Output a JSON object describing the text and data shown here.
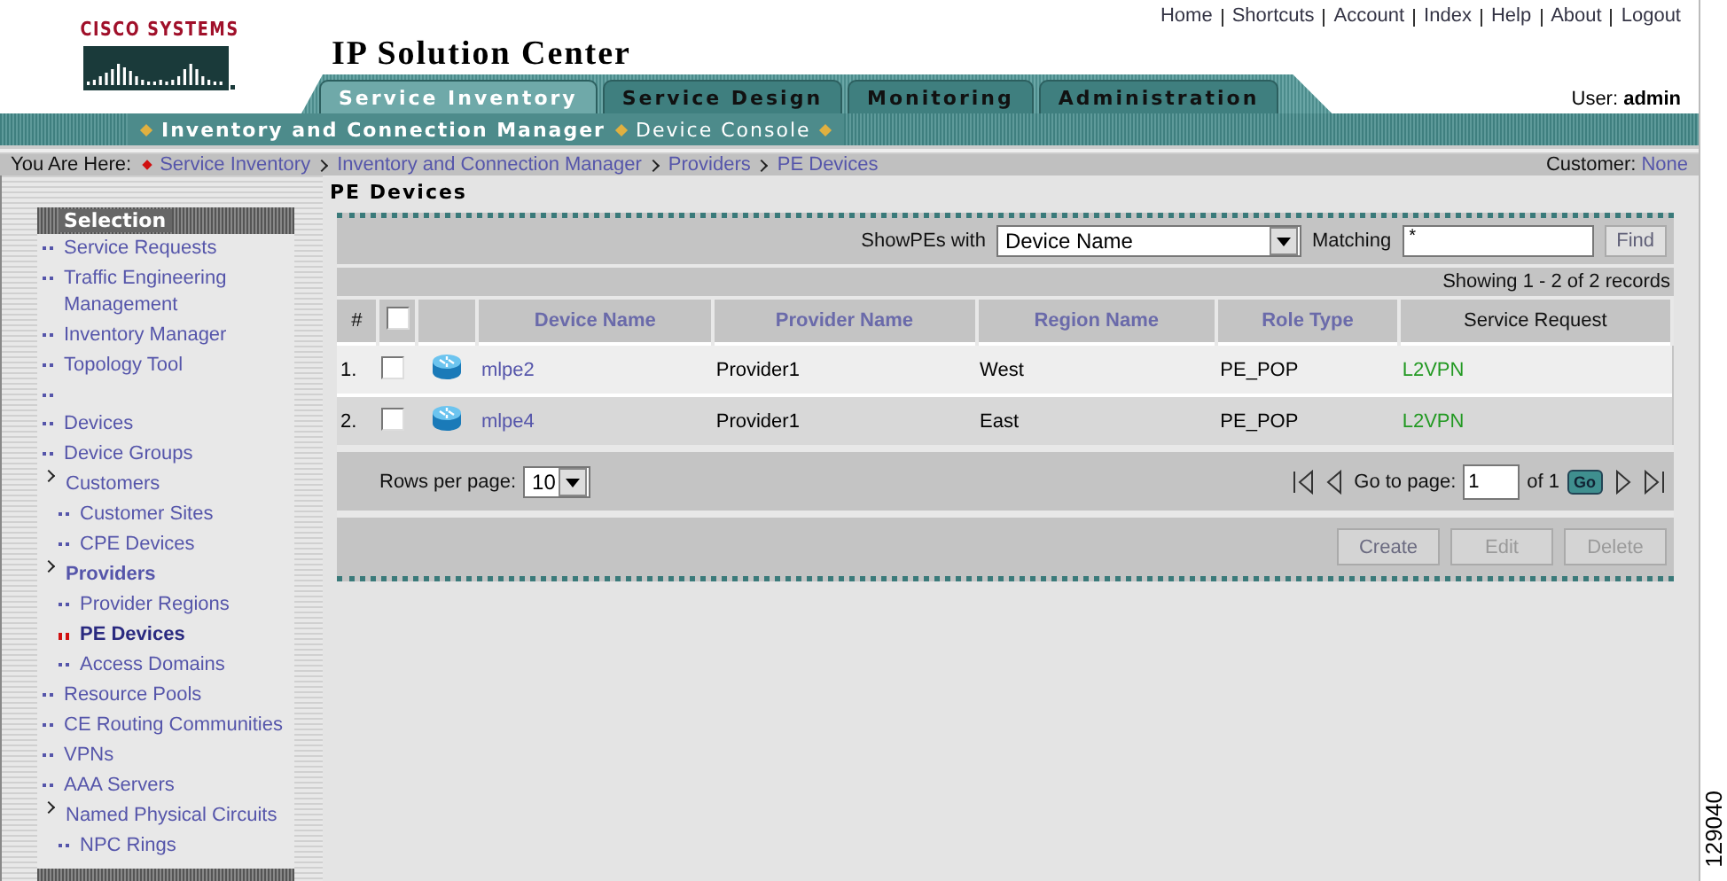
{
  "brand": {
    "company": "CISCO SYSTEMS",
    "title": "IP Solution Center"
  },
  "top_links": [
    "Home",
    "Shortcuts",
    "Account",
    "Index",
    "Help",
    "About",
    "Logout"
  ],
  "tabs": [
    {
      "label": "Service Inventory",
      "selected": true
    },
    {
      "label": "Service Design",
      "selected": false
    },
    {
      "label": "Monitoring",
      "selected": false
    },
    {
      "label": "Administration",
      "selected": false
    }
  ],
  "user": {
    "label": "User:",
    "name": "admin"
  },
  "subnav": [
    {
      "label": "Inventory and Connection Manager",
      "selected": true
    },
    {
      "label": "Device Console",
      "selected": false
    }
  ],
  "breadcrumb": {
    "label": "You Are Here:",
    "items": [
      "Service Inventory",
      "Inventory and Connection Manager",
      "Providers",
      "PE Devices"
    ],
    "customer_label": "Customer:",
    "customer": "None"
  },
  "sidebar": {
    "title": "Selection",
    "items": [
      {
        "label": "Service Requests",
        "kind": "item",
        "selected": false
      },
      {
        "label": "Traffic Engineering Management",
        "kind": "item",
        "selected": false
      },
      {
        "label": "Inventory Manager",
        "kind": "item",
        "selected": false
      },
      {
        "label": "Topology Tool",
        "kind": "item",
        "selected": false
      },
      {
        "kind": "blank",
        "selected": false
      },
      {
        "label": "Devices",
        "kind": "item",
        "selected": false
      },
      {
        "label": "Device Groups",
        "kind": "item",
        "selected": false
      },
      {
        "label": "Customers",
        "kind": "item",
        "selected": false,
        "expanded": true,
        "children": [
          {
            "label": "Customer Sites",
            "kind": "item",
            "selected": false
          },
          {
            "label": "CPE Devices",
            "kind": "item",
            "selected": false
          }
        ]
      },
      {
        "label": "Providers",
        "kind": "item",
        "selected": false,
        "expanded": true,
        "active": true,
        "children": [
          {
            "label": "Provider Regions",
            "kind": "item",
            "selected": false
          },
          {
            "label": "PE Devices",
            "kind": "item",
            "selected": true
          },
          {
            "label": "Access Domains",
            "kind": "item",
            "selected": false
          }
        ]
      },
      {
        "label": "Resource Pools",
        "kind": "item",
        "selected": false
      },
      {
        "label": "CE Routing Communities",
        "kind": "item",
        "selected": false
      },
      {
        "label": "VPNs",
        "kind": "item",
        "selected": false
      },
      {
        "label": "AAA Servers",
        "kind": "item",
        "selected": false
      },
      {
        "label": "Named Physical Circuits",
        "kind": "item",
        "selected": false,
        "expanded": true,
        "children": [
          {
            "label": "NPC Rings",
            "kind": "item",
            "selected": false
          }
        ]
      }
    ]
  },
  "page_title": "PE Devices",
  "filter": {
    "label": "ShowPEs with",
    "field": "Device Name",
    "matching_label": "Matching",
    "matching": "*",
    "button": "Find"
  },
  "summary": "Showing 1 - 2 of 2 records",
  "table": {
    "columns": [
      {
        "label": "#",
        "sortable": false
      },
      {
        "kind": "checkbox",
        "checked": false
      },
      {
        "kind": "icon"
      },
      {
        "label": "Device Name",
        "sortable": true
      },
      {
        "label": "Provider Name",
        "sortable": true
      },
      {
        "label": "Region Name",
        "sortable": true
      },
      {
        "label": "Role Type",
        "sortable": true
      },
      {
        "label": "Service Request",
        "sortable": false
      }
    ],
    "rows": [
      {
        "index": "1.",
        "checked": false,
        "device": "mlpe2",
        "provider": "Provider1",
        "region": "West",
        "role": "PE_POP",
        "service": "L2VPN"
      },
      {
        "index": "2.",
        "checked": false,
        "device": "mlpe4",
        "provider": "Provider1",
        "region": "East",
        "role": "PE_POP",
        "service": "L2VPN"
      }
    ]
  },
  "pager": {
    "rows_label": "Rows per page:",
    "rows": "10",
    "goto_label": "Go to page:",
    "page": "1",
    "of": "of 1",
    "go": "Go"
  },
  "actions": [
    {
      "label": "Create",
      "disabled": false
    },
    {
      "label": "Edit",
      "disabled": true
    },
    {
      "label": "Delete",
      "disabled": true
    }
  ],
  "figure_number": "129040"
}
